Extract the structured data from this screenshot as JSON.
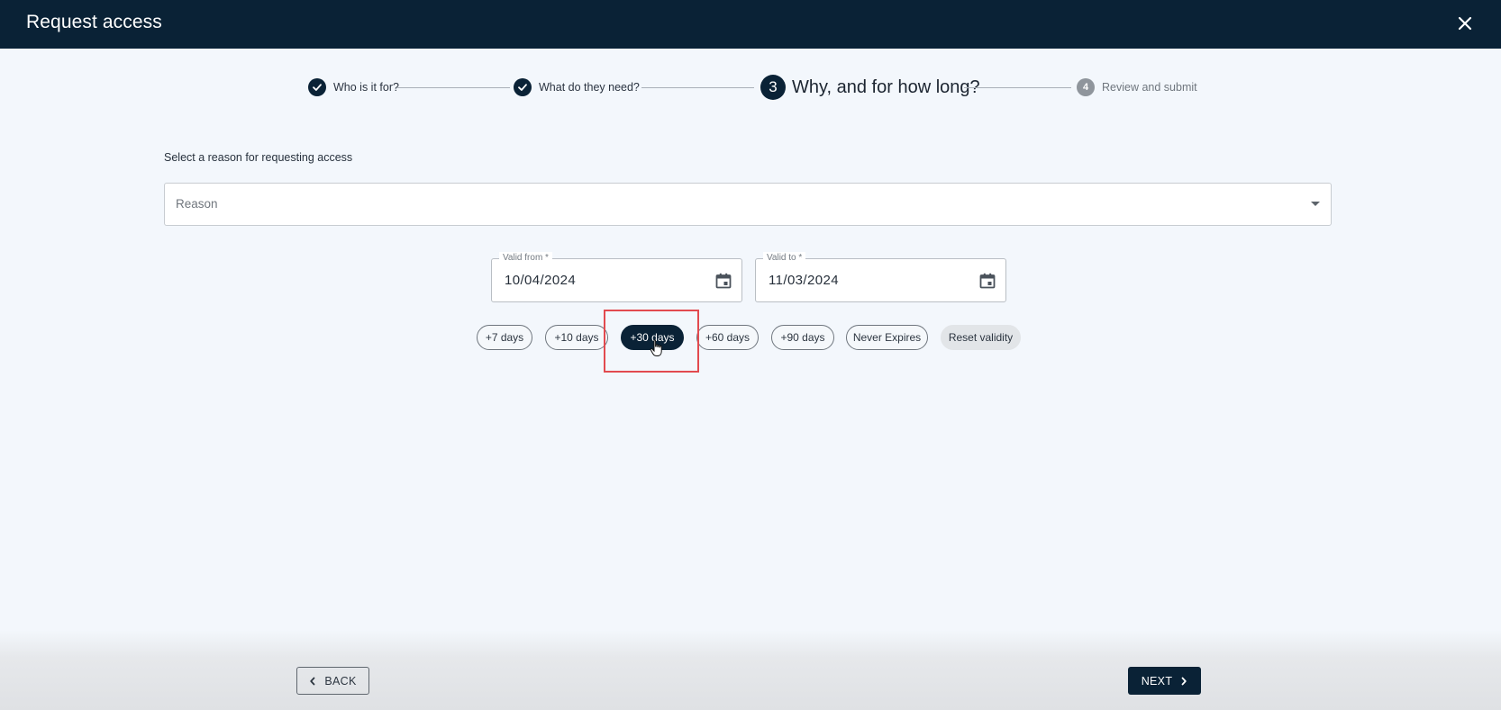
{
  "header": {
    "title": "Request access",
    "close_icon": "close-icon"
  },
  "stepper": {
    "steps": [
      {
        "label": "Who is it for?",
        "state": "complete",
        "icon": "check-icon"
      },
      {
        "label": "What do they need?",
        "state": "complete",
        "icon": "check-icon"
      },
      {
        "label": "Why, and for how long?",
        "state": "active",
        "number": "3"
      },
      {
        "label": "Review and submit",
        "state": "pending",
        "number": "4"
      }
    ]
  },
  "reason": {
    "caption": "Select a reason for requesting access",
    "placeholder": "Reason"
  },
  "validity": {
    "from": {
      "label": "Valid from *",
      "value": "10/04/2024"
    },
    "to": {
      "label": "Valid to *",
      "value": "11/03/2024"
    },
    "chips": [
      {
        "label": "+7 days",
        "selected": false
      },
      {
        "label": "+10 days",
        "selected": false
      },
      {
        "label": "+30 days",
        "selected": true
      },
      {
        "label": "+60 days",
        "selected": false
      },
      {
        "label": "+90 days",
        "selected": false
      },
      {
        "label": "Never Expires",
        "selected": false
      },
      {
        "label": "Reset validity",
        "selected": false
      }
    ]
  },
  "footer": {
    "back_label": "BACK",
    "next_label": "NEXT"
  },
  "colors": {
    "header_bg": "#0a2236",
    "page_bg": "#f3f7fc",
    "highlight": "#e24a4f",
    "primary": "#0a2236"
  }
}
